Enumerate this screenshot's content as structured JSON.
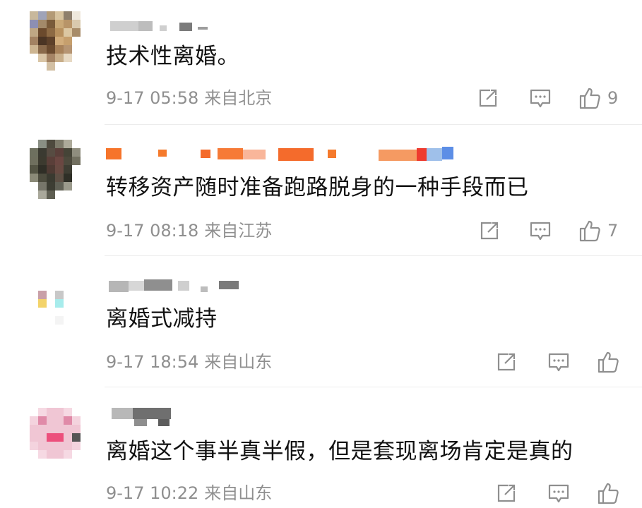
{
  "colors": {
    "text": "#111111",
    "meta": "#8f8f8f",
    "divider": "#ececec",
    "icon": "#8f8f8f"
  },
  "comments": [
    {
      "username": "",
      "text": "技术性离婚。",
      "time": "9-17 05:58",
      "location": "来自北京",
      "likes": "9"
    },
    {
      "username": "",
      "text": "转移资产随时准备跑路脱身的一种手段而已",
      "time": "9-17 08:18",
      "location": "来自江苏",
      "likes": "7"
    },
    {
      "username": "",
      "text": "离婚式减持",
      "time": "9-17 18:54",
      "location": "来自山东",
      "likes": ""
    },
    {
      "username": "",
      "text": "离婚这个事半真半假，但是套现离场肯定是真的",
      "time": "9-17 10:22",
      "location": "来自山东",
      "likes": ""
    }
  ],
  "icons": {
    "repost": "repost-icon",
    "comment": "comment-icon",
    "like": "like-icon"
  }
}
